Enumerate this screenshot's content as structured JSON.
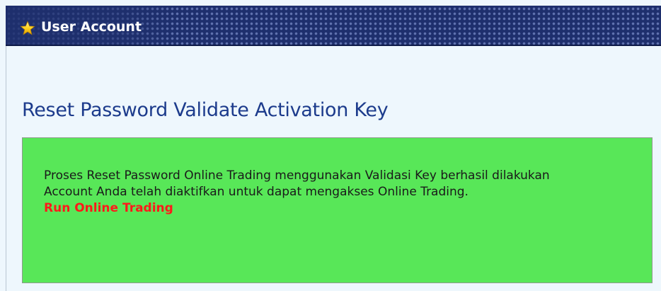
{
  "header": {
    "title": "User Account",
    "icon": "star-icon"
  },
  "main": {
    "page_title": "Reset Password Validate Activation Key",
    "message": {
      "line1": "Proses Reset Password Online Trading menggunakan Validasi Key berhasil dilakukan",
      "line2": "Account Anda telah diaktifkan untuk dapat mengakses Online Trading.",
      "link_label": "Run Online Trading"
    }
  },
  "colors": {
    "header_bg": "#1e2f6d",
    "page_bg": "#eef7fd",
    "title_color": "#1c3b8c",
    "success_bg": "#58e758",
    "link_color": "#ff1a1a"
  }
}
